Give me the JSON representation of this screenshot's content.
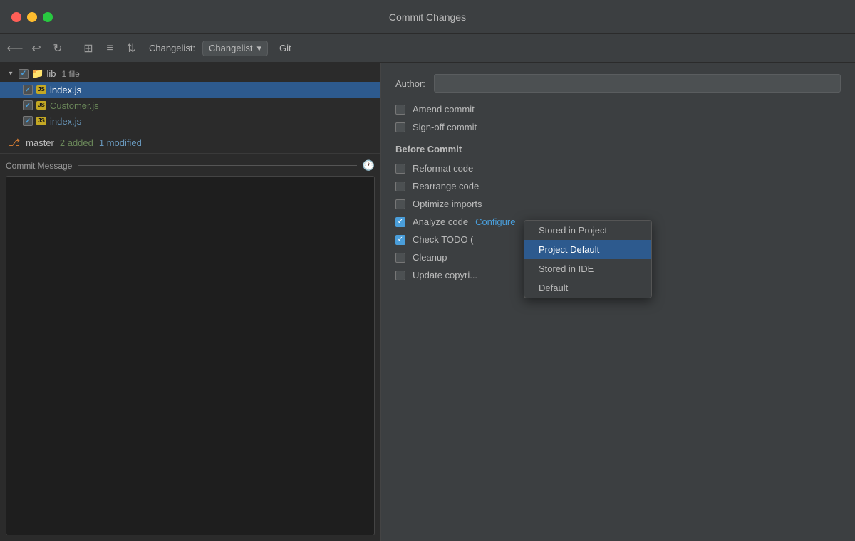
{
  "window": {
    "title": "Commit Changes"
  },
  "toolbar": {
    "changelist_label": "Changelist:",
    "changelist_value": "Changelist",
    "git_label": "Git"
  },
  "file_tree": {
    "folder": {
      "name": "lib",
      "count": "1 file",
      "expanded": true
    },
    "files": [
      {
        "name": "index.js",
        "color": "selected",
        "checked": true
      },
      {
        "name": "Customer.js",
        "color": "green",
        "checked": true
      },
      {
        "name": "index.js",
        "color": "blue",
        "checked": true
      }
    ]
  },
  "branch": {
    "name": "master",
    "added": "2 added",
    "modified": "1 modified"
  },
  "commit_message": {
    "label": "Commit Message"
  },
  "author": {
    "label": "Author:",
    "placeholder": ""
  },
  "options": {
    "amend_commit": {
      "label": "Amend commit",
      "checked": false
    },
    "sign_off_commit": {
      "label": "Sign-off commit",
      "checked": false
    }
  },
  "before_commit": {
    "section_label": "Before Commit",
    "reformat_code": {
      "label": "Reformat code",
      "checked": false
    },
    "rearrange_code": {
      "label": "Rearrange code",
      "checked": false
    },
    "optimize_imports": {
      "label": "Optimize imports",
      "checked": false
    },
    "analyze_code": {
      "label": "Analyze code",
      "checked": true,
      "configure_label": "Configure"
    },
    "check_todo": {
      "label": "Check TODO (",
      "checked": true
    },
    "cleanup": {
      "label": "Cleanup",
      "checked": false
    },
    "update_copyright": {
      "label": "Update copyri...",
      "checked": false
    }
  },
  "dropdown": {
    "items": [
      {
        "label": "Stored in Project",
        "active": false
      },
      {
        "label": "Project Default",
        "active": true
      },
      {
        "label": "Stored in IDE",
        "active": false
      },
      {
        "label": "Default",
        "active": false
      }
    ]
  }
}
